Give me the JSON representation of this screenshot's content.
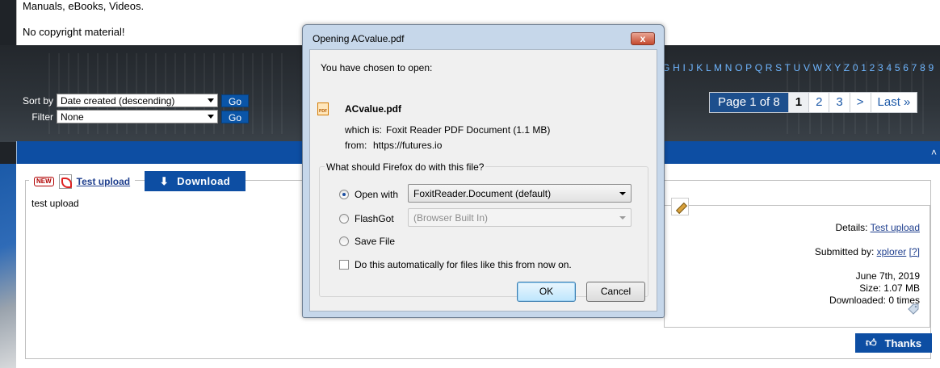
{
  "page": {
    "intro_line": "Manuals, eBooks, Videos.",
    "copyright_line": "No copyright material!"
  },
  "filters": {
    "sort_label": "Sort by",
    "sort_value": "Date created (descending)",
    "filter_label": "Filter",
    "filter_value": "None",
    "go_label": "Go"
  },
  "alphabet": "G H I J K L M N O P Q R S T U V W X Y Z 0 1 2 3 4 5 6 7 8 9",
  "pager": {
    "status": "Page 1 of 8",
    "pages": [
      "1",
      "2",
      "3"
    ],
    "next": ">",
    "last": "Last »"
  },
  "listing": {
    "title": "Test upload",
    "download_label": "Download",
    "description": "test upload",
    "details_label": "Details:",
    "details_value": "Test upload",
    "submitted_label": "Submitted by:",
    "submitted_user": "xplorer",
    "submitted_help": "[?]",
    "date": "June 7th, 2019",
    "size": "Size: 1.07 MB",
    "downloaded": "Downloaded: 0 times",
    "thanks_label": "Thanks"
  },
  "dialog": {
    "title": "Opening ACvalue.pdf",
    "close_label": "x",
    "intro": "You have chosen to open:",
    "filename": "ACvalue.pdf",
    "which_is_label": "which is:",
    "which_is_value": "Foxit Reader PDF Document (1.1 MB)",
    "from_label": "from:",
    "from_value": "https://futures.io",
    "question": "What should Firefox do with this file?",
    "open_with_label": "Open with",
    "open_with_value": "FoxitReader.Document (default)",
    "flashgot_label": "FlashGot",
    "flashgot_value": "(Browser Built In)",
    "save_file_label": "Save File",
    "auto_label": "Do this automatically for files like this from now on.",
    "ok_label": "OK",
    "cancel_label": "Cancel"
  },
  "colors": {
    "accent_blue": "#0d4ea3",
    "link_blue": "#1f3f8e",
    "dialog_frame": "#c6d7ea"
  }
}
